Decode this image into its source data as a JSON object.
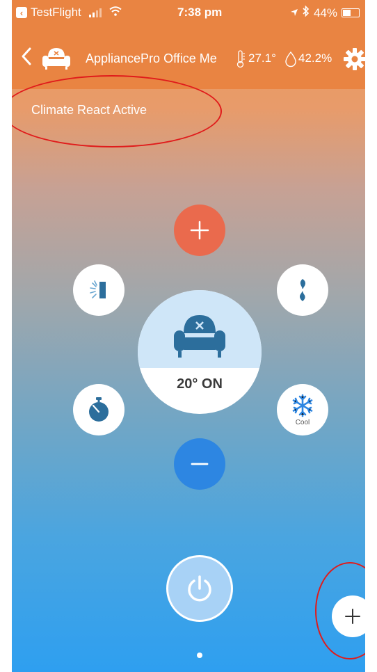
{
  "status_bar": {
    "back_app_label": "TestFlight",
    "time": "7:38 pm",
    "battery": "44%",
    "battery_level": 0.44
  },
  "header": {
    "title": "AppliancePro Office Me",
    "temperature": "27.1°",
    "humidity": "42.2%"
  },
  "banner": {
    "text": "Climate React Active"
  },
  "controls": {
    "temperature_display": "20°  ON",
    "mode_label": "Cool"
  },
  "icons": {
    "back": "chevron-left-icon",
    "avatar": "armchair-icon",
    "thermometer": "thermometer-icon",
    "humidity": "droplet-icon",
    "settings": "gear-icon",
    "increase": "plus-icon",
    "decrease": "minus-icon",
    "swing": "swing-icon",
    "fan": "fan-icon",
    "timer": "stopwatch-icon",
    "mode": "snowflake-icon",
    "power": "power-icon",
    "add": "plus-icon"
  },
  "colors": {
    "header": "#e98442",
    "plus_button": "#ea6a4d",
    "minus_button": "#2d86e2",
    "annotation": "#e01b1b"
  }
}
